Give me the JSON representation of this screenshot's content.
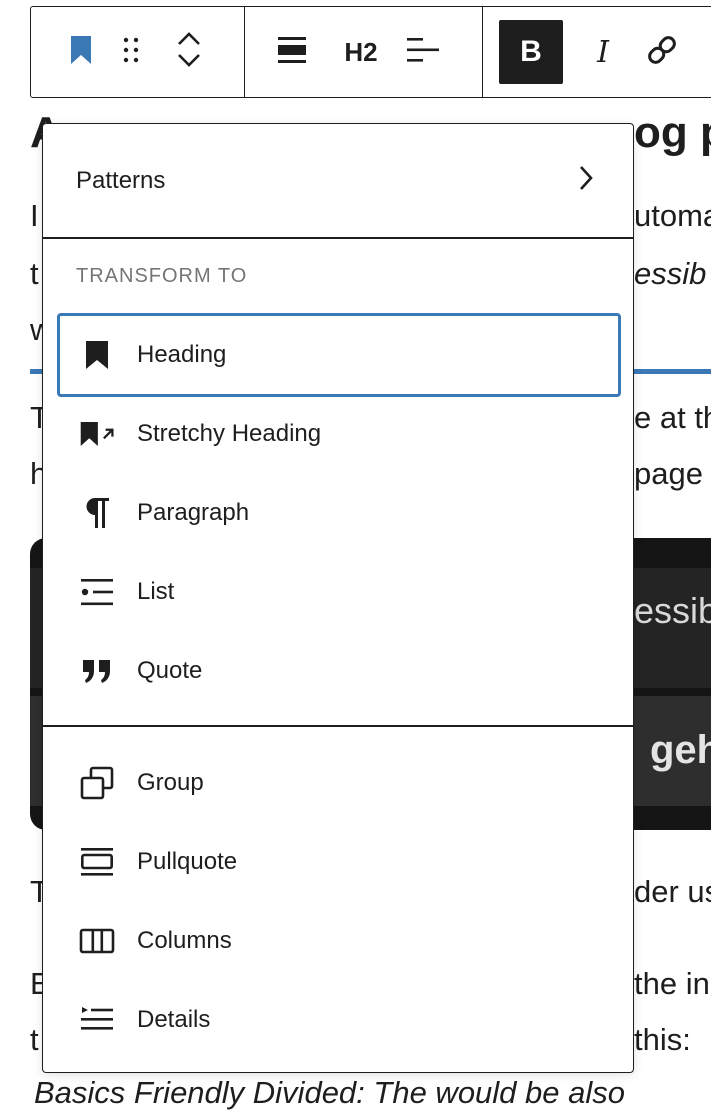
{
  "background": {
    "title_fragment_left": "A",
    "title_fragment_right": "og p",
    "lines": [
      {
        "left": "I",
        "right": "utoma"
      },
      {
        "left": "t",
        "right": "essib"
      },
      {
        "left": "w",
        "right": ""
      },
      {
        "left": "T",
        "right": "e at th"
      },
      {
        "left": "h",
        "right": "page i"
      },
      {
        "left": "T",
        "right": "der us"
      },
      {
        "left": "E",
        "right": "the in"
      },
      {
        "left": "t",
        "right": "this:"
      }
    ],
    "bottom_line": "Basics Friendly Divided: The would be also",
    "image_text_1": "essib",
    "image_text_2": "geh"
  },
  "toolbar": {
    "heading_level_label": "H2",
    "bold_label": "B",
    "italic_label": "I",
    "icons": [
      "bookmark-icon",
      "drag-handle-icon",
      "move-up-down-icon",
      "align-icon",
      "text-align-icon",
      "link-icon"
    ]
  },
  "menu": {
    "patterns_label": "Patterns",
    "transform_section_label": "TRANSFORM TO",
    "transform_items": [
      {
        "label": "Heading",
        "icon": "bookmark-icon",
        "selected": true
      },
      {
        "label": "Stretchy Heading",
        "icon": "stretchy-heading-icon"
      },
      {
        "label": "Paragraph",
        "icon": "paragraph-icon"
      },
      {
        "label": "List",
        "icon": "list-icon"
      },
      {
        "label": "Quote",
        "icon": "quote-icon"
      }
    ],
    "wrap_items": [
      {
        "label": "Group",
        "icon": "group-icon"
      },
      {
        "label": "Pullquote",
        "icon": "pullquote-icon"
      },
      {
        "label": "Columns",
        "icon": "columns-icon"
      },
      {
        "label": "Details",
        "icon": "details-icon"
      }
    ]
  },
  "colors": {
    "accent": "#3a78b6",
    "text": "#1e1e1e",
    "muted": "#757575",
    "bold_button_bg": "#1e1e1e"
  }
}
